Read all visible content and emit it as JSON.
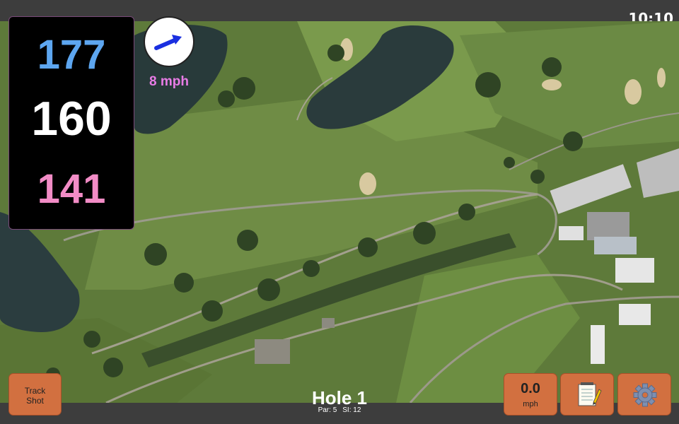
{
  "status": {
    "time": "10:10"
  },
  "yardages": {
    "back": "177",
    "middle": "160",
    "front": "141"
  },
  "wind": {
    "speed_label": "8 mph",
    "icon": "wind-arrow-icon"
  },
  "hole": {
    "title": "Hole 1",
    "par_label": "Par: 5",
    "si_label": "SI: 12"
  },
  "buttons": {
    "track_shot_line1": "Track",
    "track_shot_line2": "Shot",
    "speed_value": "0.0",
    "speed_unit": "mph",
    "notes_icon": "notepad-icon",
    "settings_icon": "gear-icon"
  },
  "colors": {
    "back": "#5da6f0",
    "middle": "#ffffff",
    "front": "#f28cc6",
    "wind_text": "#e87ce6",
    "button": "#d27040"
  }
}
